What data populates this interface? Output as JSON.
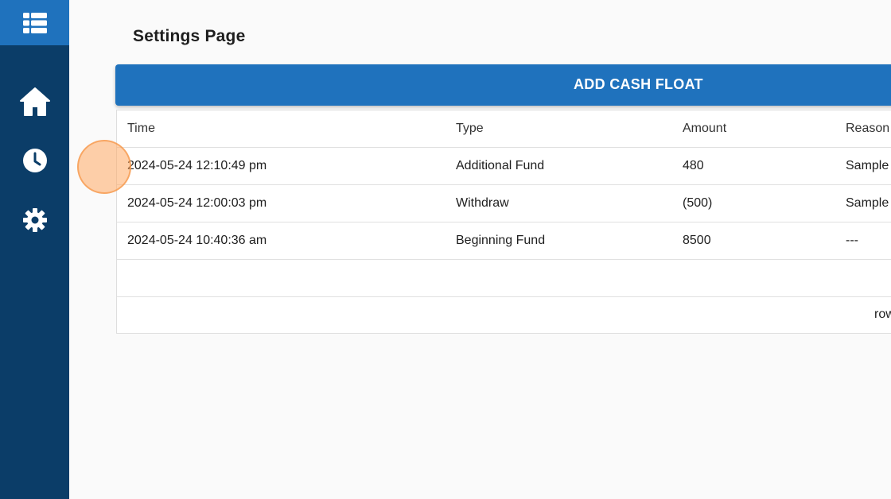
{
  "sidebar": {
    "menu_icon": "table-list-icon",
    "items": [
      {
        "icon": "home-icon"
      },
      {
        "icon": "clock-icon"
      },
      {
        "icon": "gear-icon"
      }
    ]
  },
  "page": {
    "title": "Settings Page",
    "add_button_label": "ADD CASH FLOAT"
  },
  "table": {
    "columns": [
      "Time",
      "Type",
      "Amount",
      "Reason"
    ],
    "rows": [
      {
        "time": "2024-05-24 12:10:49 pm",
        "type": "Additional Fund",
        "amount": "480",
        "reason": "Sample"
      },
      {
        "time": "2024-05-24 12:00:03 pm",
        "type": "Withdraw",
        "amount": "(500)",
        "reason": "Sample"
      },
      {
        "time": "2024-05-24 10:40:36 am",
        "type": "Beginning Fund",
        "amount": "8500",
        "reason": "---"
      }
    ],
    "footer_text": "rows"
  },
  "colors": {
    "sidebar_bg": "#0b3d68",
    "accent": "#1f72bd",
    "cursor_highlight": "#ffaa64"
  }
}
